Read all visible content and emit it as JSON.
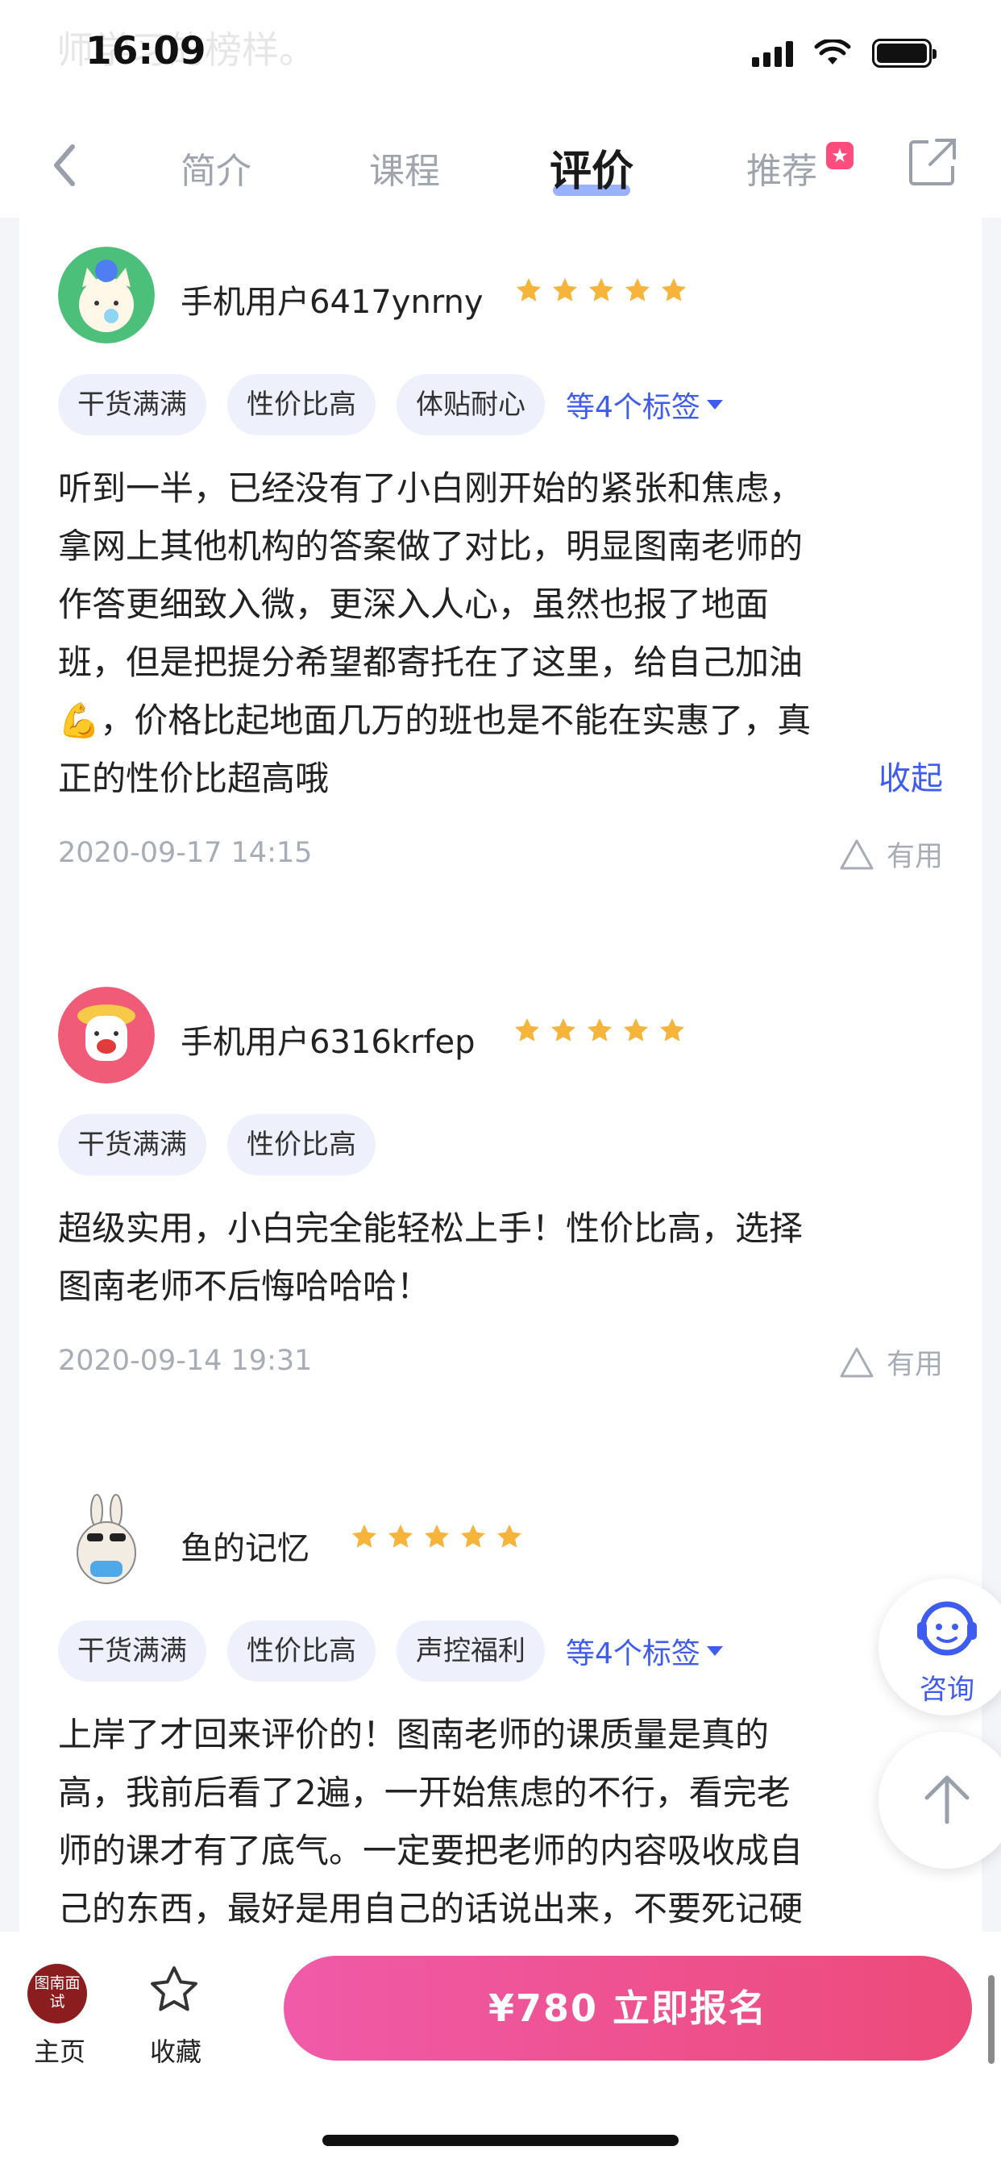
{
  "status_bar": {
    "time": "16:09"
  },
  "ghost_text": "师学习的榜样。",
  "nav": {
    "tabs": [
      {
        "label": "简介"
      },
      {
        "label": "课程"
      },
      {
        "label": "评价"
      },
      {
        "label": "推荐"
      }
    ],
    "active_tab": "评价"
  },
  "reviews": [
    {
      "username": "手机用户6417ynrny",
      "rating": 5,
      "tags": [
        "干货满满",
        "性价比高",
        "体贴耐心"
      ],
      "more_tags": "等4个标签",
      "content_lines": [
        "听到一半，已经没有了小白刚开始的紧张和焦虑，",
        "拿网上其他机构的答案做了对比，明显图南老师的",
        "作答更细致入微，更深入人心，虽然也报了地面",
        "班，但是把提分希望都寄托在了这里，给自己加油",
        "💪，价格比起地面几万的班也是不能在实惠了，真",
        "正的性价比超高哦"
      ],
      "collapse": "收起",
      "date": "2020-09-17 14:15",
      "useful": "有用"
    },
    {
      "username": "手机用户6316krfep",
      "rating": 5,
      "tags": [
        "干货满满",
        "性价比高"
      ],
      "content_lines": [
        "超级实用，小白完全能轻松上手！性价比高，选择",
        "图南老师不后悔哈哈哈！"
      ],
      "date": "2020-09-14 19:31",
      "useful": "有用"
    },
    {
      "username": "鱼的记忆",
      "rating": 5,
      "tags": [
        "干货满满",
        "性价比高",
        "声控福利"
      ],
      "more_tags": "等4个标签",
      "content_lines": [
        "上岸了才回来评价的！图南老师的课质量是真的",
        "高，我前后看了2遍，一开始焦虑的不行，看完老",
        "师的课才有了底气。一定要把老师的内容吸收成自",
        "己的东西，最好是用自己的话说出来，不要死记硬"
      ]
    }
  ],
  "floating": {
    "consult": "咨询"
  },
  "bottom": {
    "home_logo": "图南面试",
    "home_label": "主页",
    "fav_label": "收藏",
    "cta": "¥780  立即报名"
  },
  "colors": {
    "accent": "#3f5cf0",
    "star": "#f7b43a",
    "cta_start": "#f05aa8",
    "cta_end": "#ec4a79"
  }
}
